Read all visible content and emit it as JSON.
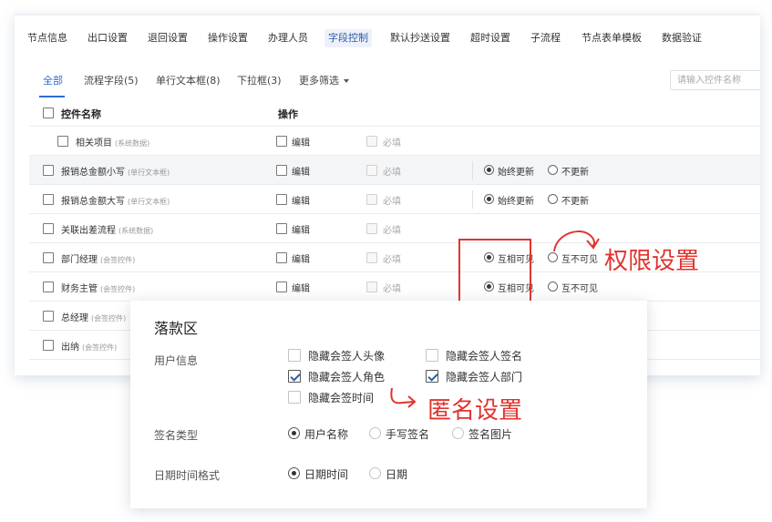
{
  "top_tabs": [
    "节点信息",
    "出口设置",
    "退回设置",
    "操作设置",
    "办理人员",
    "字段控制",
    "默认抄送设置",
    "超时设置",
    "子流程",
    "节点表单模板",
    "数据验证"
  ],
  "top_tab_active": "字段控制",
  "sub_tabs": {
    "all": "全部",
    "flow_fields": "流程字段(5)",
    "single_text": "单行文本框(8)",
    "dropdown": "下拉框(3)",
    "more_filter": "更多筛选"
  },
  "search": {
    "placeholder": "请输入控件名称",
    "value": ""
  },
  "table": {
    "header": {
      "name": "控件名称",
      "action": "操作"
    },
    "edit_label": "编辑",
    "required_label": "必填",
    "rows": [
      {
        "name": "相关项目",
        "tag": "(系统数据)"
      },
      {
        "name": "报销总金额小写",
        "tag": "(单行文本框)",
        "opt1": "始终更新",
        "opt2": "不更新"
      },
      {
        "name": "报销总金额大写",
        "tag": "(单行文本框)",
        "opt1": "始终更新",
        "opt2": "不更新"
      },
      {
        "name": "关联出差流程",
        "tag": "(系统数据)"
      },
      {
        "name": "部门经理",
        "tag": "(会签控件)",
        "opt1": "互相可见",
        "opt2": "互不可见"
      },
      {
        "name": "财务主管",
        "tag": "(会签控件)",
        "opt1": "互相可见",
        "opt2": "互不可见"
      },
      {
        "name": "总经理",
        "tag": "(会签控件)"
      },
      {
        "name": "出纳",
        "tag": "(会签控件)"
      }
    ]
  },
  "annotations": {
    "permission": "权限设置",
    "anonymous": "匿名设置",
    "color": "#e0342e"
  },
  "signature_panel": {
    "title": "落款区",
    "user_info_label": "用户信息",
    "user_info_options": [
      {
        "label": "隐藏会签人头像",
        "checked": false
      },
      {
        "label": "隐藏会签人签名",
        "checked": false
      },
      {
        "label": "隐藏会签人角色",
        "checked": true
      },
      {
        "label": "隐藏会签人部门",
        "checked": true
      },
      {
        "label": "隐藏会签时间",
        "checked": false
      }
    ],
    "sign_type_label": "签名类型",
    "sign_type_options": [
      "用户名称",
      "手写签名",
      "签名图片"
    ],
    "sign_type_selected": "用户名称",
    "datetime_label": "日期时间格式",
    "datetime_options": [
      "日期时间",
      "日期"
    ],
    "datetime_selected": "日期时间"
  }
}
